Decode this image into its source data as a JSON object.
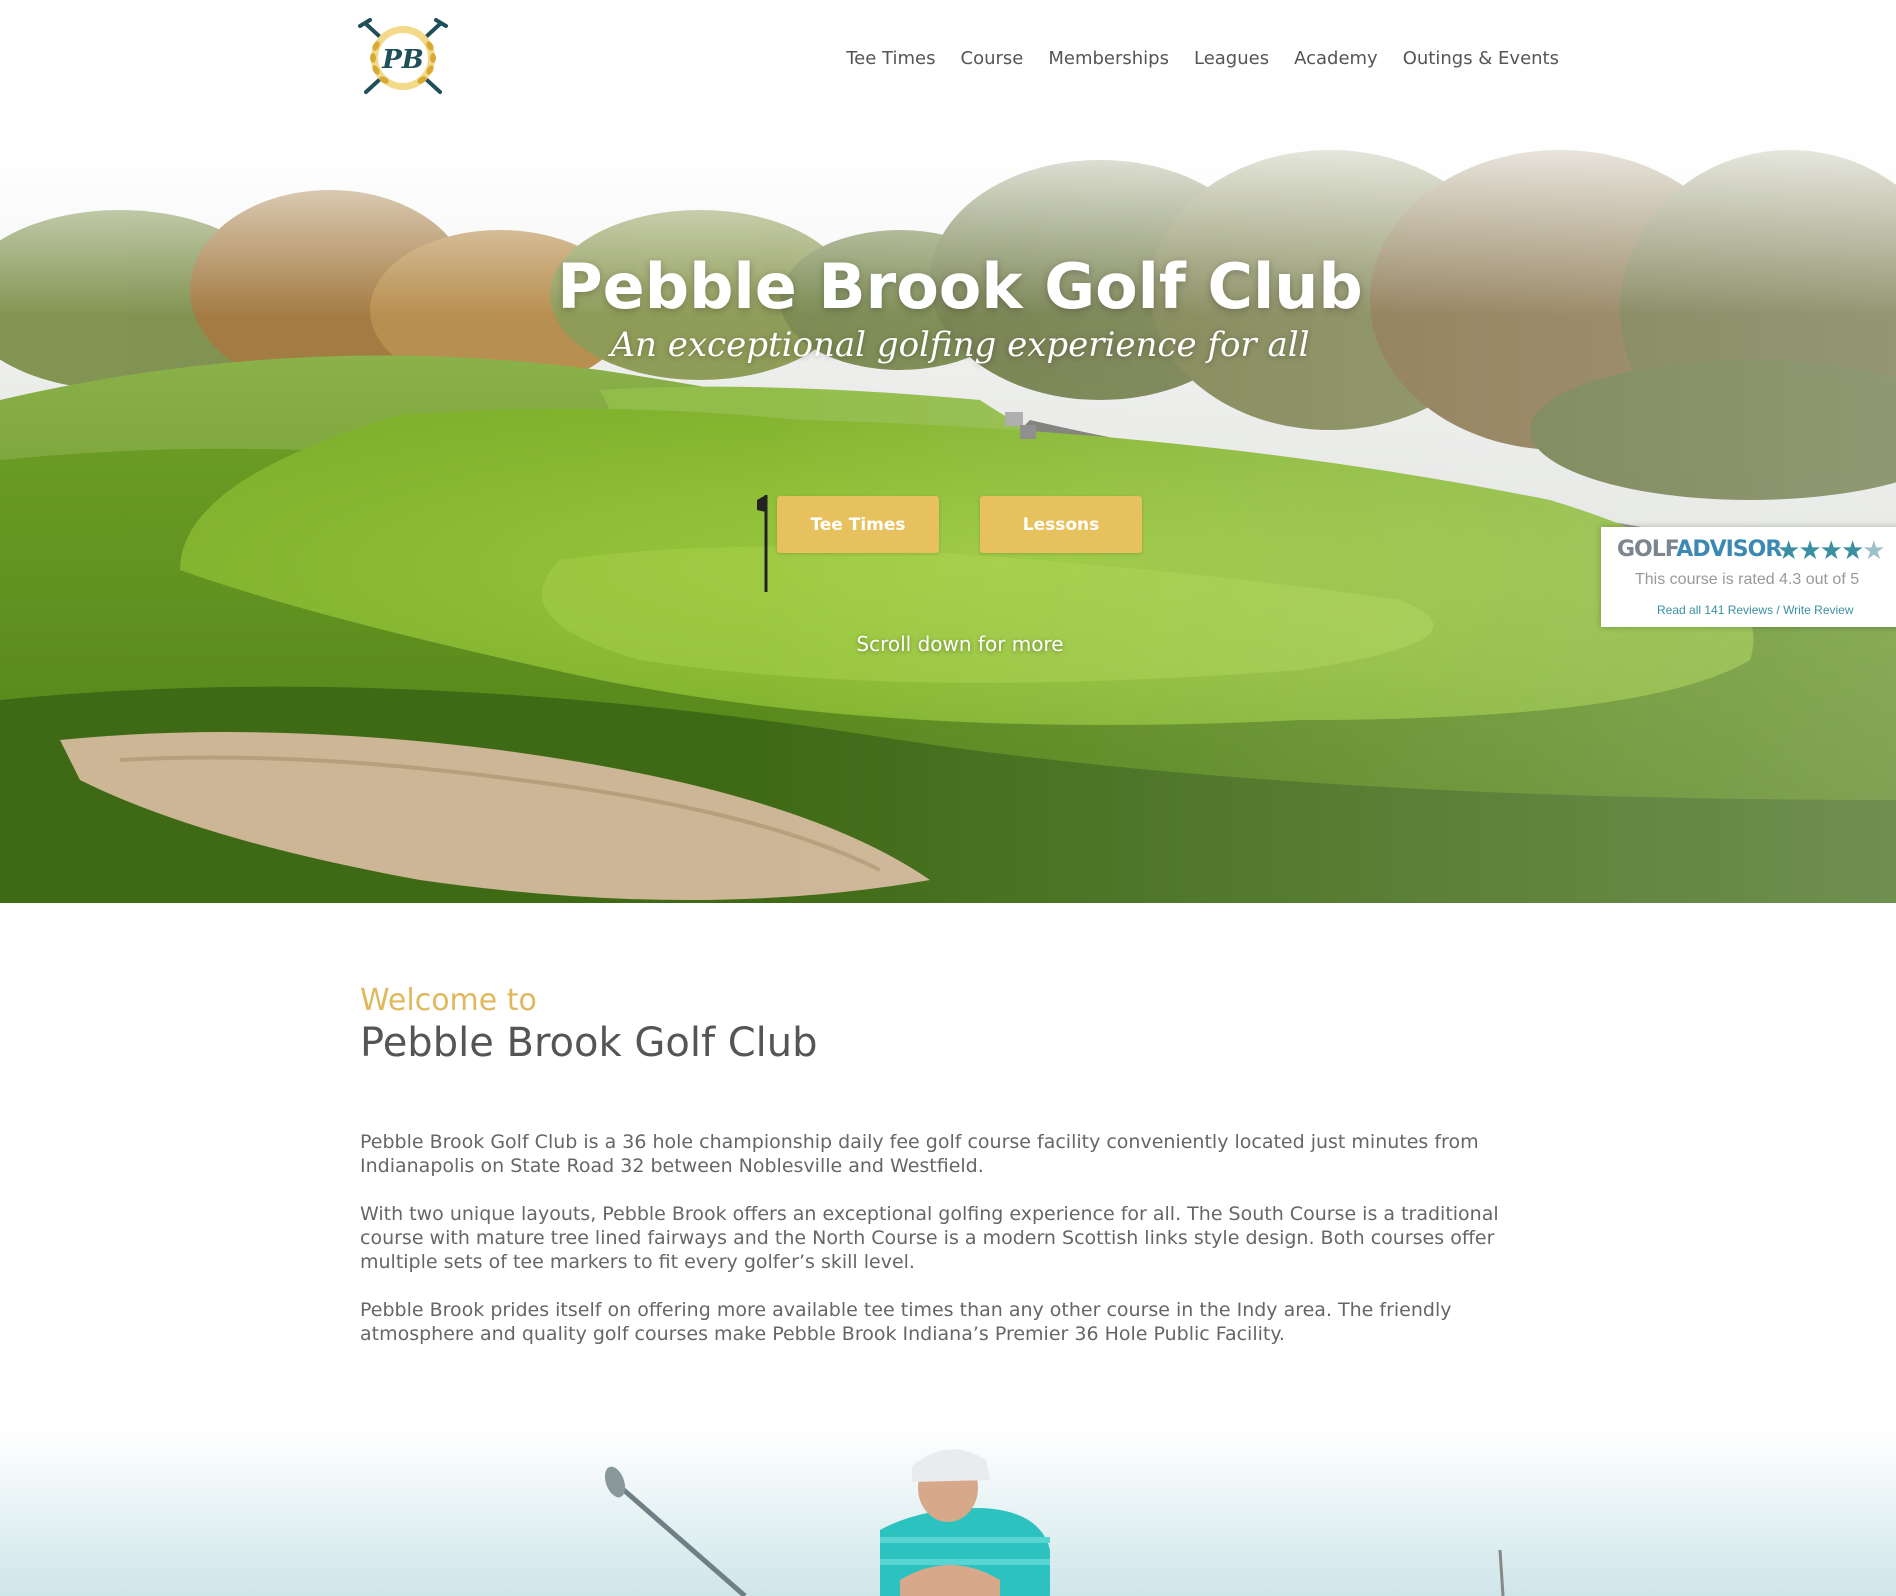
{
  "header": {
    "logo_alt": "PB",
    "nav": [
      "Tee Times",
      "Course",
      "Memberships",
      "Leagues",
      "Academy",
      "Outings & Events"
    ]
  },
  "hero": {
    "title": "Pebble Brook Golf Club",
    "tagline": "An exceptional golfing experience for all",
    "buttons": {
      "tee_times": "Tee Times",
      "lessons": "Lessons"
    },
    "scroll_hint": "Scroll down for more"
  },
  "golf_advisor": {
    "brand_golf": "GOLF",
    "brand_advisor": "ADVISOR",
    "rating_text": "This course is rated 4.3 out of 5",
    "rating": 4.3,
    "reviews_link": "Read all 141 Reviews / Write Review"
  },
  "welcome": {
    "kicker": "Welcome to",
    "heading": "Pebble Brook Golf Club",
    "paragraphs": [
      "Pebble Brook Golf Club is a 36 hole championship daily fee golf course facility conveniently located just minutes from Indianapolis on State Road 32 between Noblesville and Westfield.",
      "With two unique layouts, Pebble Brook offers an exceptional golfing experience for all. The South Course is a traditional course with mature tree lined fairways and the North Course is a modern Scottish links style design. Both courses offer multiple sets of tee markers to fit every golfer’s skill level.",
      "Pebble Brook prides itself on offering more available tee times than any other course in the Indy area. The friendly atmosphere and quality golf courses make Pebble Brook Indiana’s Premier 36 Hole Public Facility."
    ]
  },
  "colors": {
    "accent_gold": "#e8c15f",
    "kicker_gold": "#e0b85d",
    "golf_advisor_blue": "#3b88b3",
    "star_teal": "#3a8fa0"
  },
  "icons": [
    "pebble-brook-logo-icon",
    "crossed-clubs-icon",
    "laurel-wreath-icon",
    "star-icon",
    "flag-icon"
  ]
}
